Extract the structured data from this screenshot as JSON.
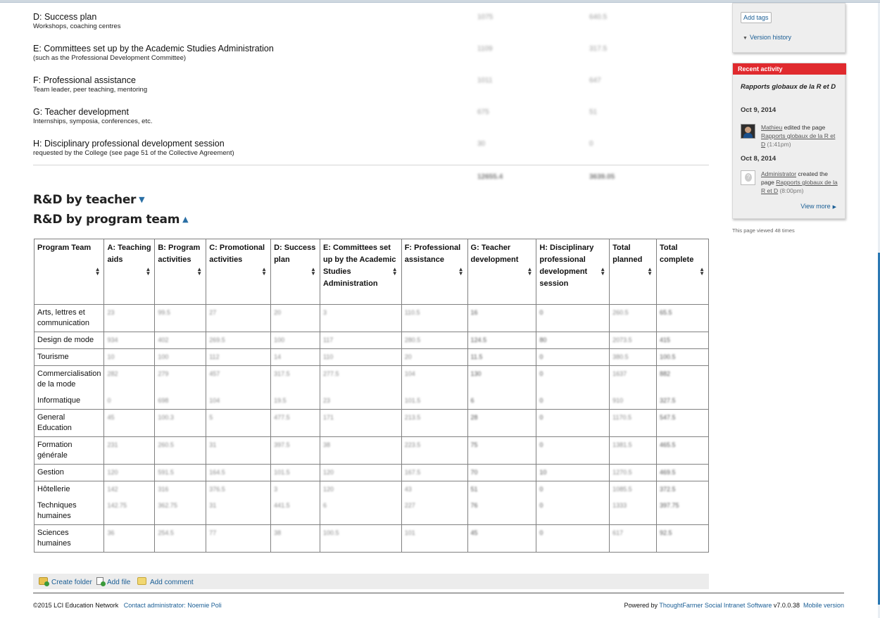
{
  "categories": [
    {
      "title": "D: Success plan",
      "sub": "Workshops, coaching centres",
      "v1": "1075",
      "v2": "640.5"
    },
    {
      "title": "E: Committees set up by the Academic Studies Administration",
      "sub": "(such as the Professional Development Committee)",
      "v1": "1109",
      "v2": "317.5"
    },
    {
      "title": "F: Professional assistance",
      "sub": "Team leader, peer teaching, mentoring",
      "v1": "1011",
      "v2": "647"
    },
    {
      "title": "G: Teacher development",
      "sub": "Internships, symposia, conferences, etc.",
      "v1": "675",
      "v2": "51"
    },
    {
      "title": "H: Disciplinary professional development session",
      "sub": "requested by the College (see page 51 of the Collective Agreement)",
      "v1": "30",
      "v2": "0"
    }
  ],
  "totals": {
    "v1": "12655.4",
    "v2": "3639.05"
  },
  "sections": {
    "by_teacher": "R&D by teacher",
    "by_program": "R&D by program team"
  },
  "table": {
    "headers": [
      "Program Team",
      "A: Teaching aids",
      "B: Program activities",
      "C: Promotional activities",
      "D: Success plan",
      "E: Committees set up by the Academic Studies Administration",
      "F: Professional assistance",
      "G: Teacher development",
      "H: Disciplinary professional development session",
      "Total planned",
      "Total complete"
    ],
    "rows": [
      {
        "team": "Arts, lettres et communication",
        "vals": [
          "23",
          "99.5",
          "27",
          "20",
          "3",
          "110.5",
          "16",
          "0",
          "260.5",
          "65.5"
        ]
      },
      {
        "team": "Design de mode",
        "vals": [
          "934",
          "402",
          "269.5",
          "100",
          "117",
          "280.5",
          "124.5",
          "80",
          "2073.5",
          "415"
        ]
      },
      {
        "team": "Tourisme",
        "vals": [
          "10",
          "100",
          "112",
          "14",
          "110",
          "20",
          "11.5",
          "0",
          "380.5",
          "100.5"
        ]
      },
      {
        "team": "Commercialisation de la mode",
        "vals": [
          "282",
          "279",
          "457",
          "317.5",
          "277.5",
          "104",
          "130",
          "0",
          "1637",
          "882"
        ]
      },
      {
        "team": "Informatique",
        "vals": [
          "0",
          "698",
          "104",
          "19.5",
          "23",
          "101.5",
          "6",
          "0",
          "910",
          "327.5"
        ]
      },
      {
        "team": "General Education",
        "vals": [
          "45",
          "100.3",
          "5",
          "477.5",
          "171",
          "213.5",
          "28",
          "0",
          "1170.5",
          "547.5"
        ]
      },
      {
        "team": "Formation générale",
        "vals": [
          "231",
          "260.5",
          "31",
          "397.5",
          "38",
          "223.5",
          "75",
          "0",
          "1381.5",
          "465.5"
        ]
      },
      {
        "team": "Gestion",
        "vals": [
          "120",
          "591.5",
          "164.5",
          "101.5",
          "120",
          "167.5",
          "70",
          "10",
          "1270.5",
          "469.5"
        ]
      },
      {
        "team": "Hôtellerie",
        "vals": [
          "142",
          "316",
          "376.5",
          "3",
          "120",
          "43",
          "51",
          "0",
          "1085.5",
          "372.5"
        ]
      },
      {
        "team": "Techniques humaines",
        "vals": [
          "142.75",
          "362.75",
          "31",
          "441.5",
          "6",
          "227",
          "76",
          "0",
          "1333",
          "397.75"
        ]
      },
      {
        "team": "Sciences humaines",
        "vals": [
          "36",
          "254.5",
          "77",
          "38",
          "100.5",
          "101",
          "45",
          "0",
          "617",
          "92.5"
        ]
      }
    ]
  },
  "actions": {
    "create_folder": "Create folder",
    "add_file": "Add file",
    "add_comment": "Add comment"
  },
  "footer": {
    "copyright": "©2015 LCI Education Network",
    "contact": "Contact administrator: Noemie Poli",
    "powered_prefix": "Powered by",
    "powered_link": "ThoughtFarmer Social Intranet Software",
    "version": "v7.0.0.38",
    "mobile": "Mobile version"
  },
  "sidebar": {
    "add_tags": "Add tags",
    "version_history": "Version history",
    "recent_activity": "Recent activity",
    "page_title": "Rapports globaux de la R et D",
    "items": [
      {
        "date": "Oct 9, 2014",
        "user": "Mathieu",
        "action": "edited the page",
        "page": "Rapports globaux de la R et D",
        "time": "(1:41pm)"
      },
      {
        "date": "Oct 8, 2014",
        "user": "Administrator",
        "action": "created the page",
        "page": "Rapports globaux de la R et D",
        "time": "(8:00pm)"
      }
    ],
    "view_more": "View more",
    "viewed": "This page viewed 48 times"
  },
  "colors": {
    "accent": "#1a5e95",
    "recent_activity_header": "#e02a2e"
  }
}
